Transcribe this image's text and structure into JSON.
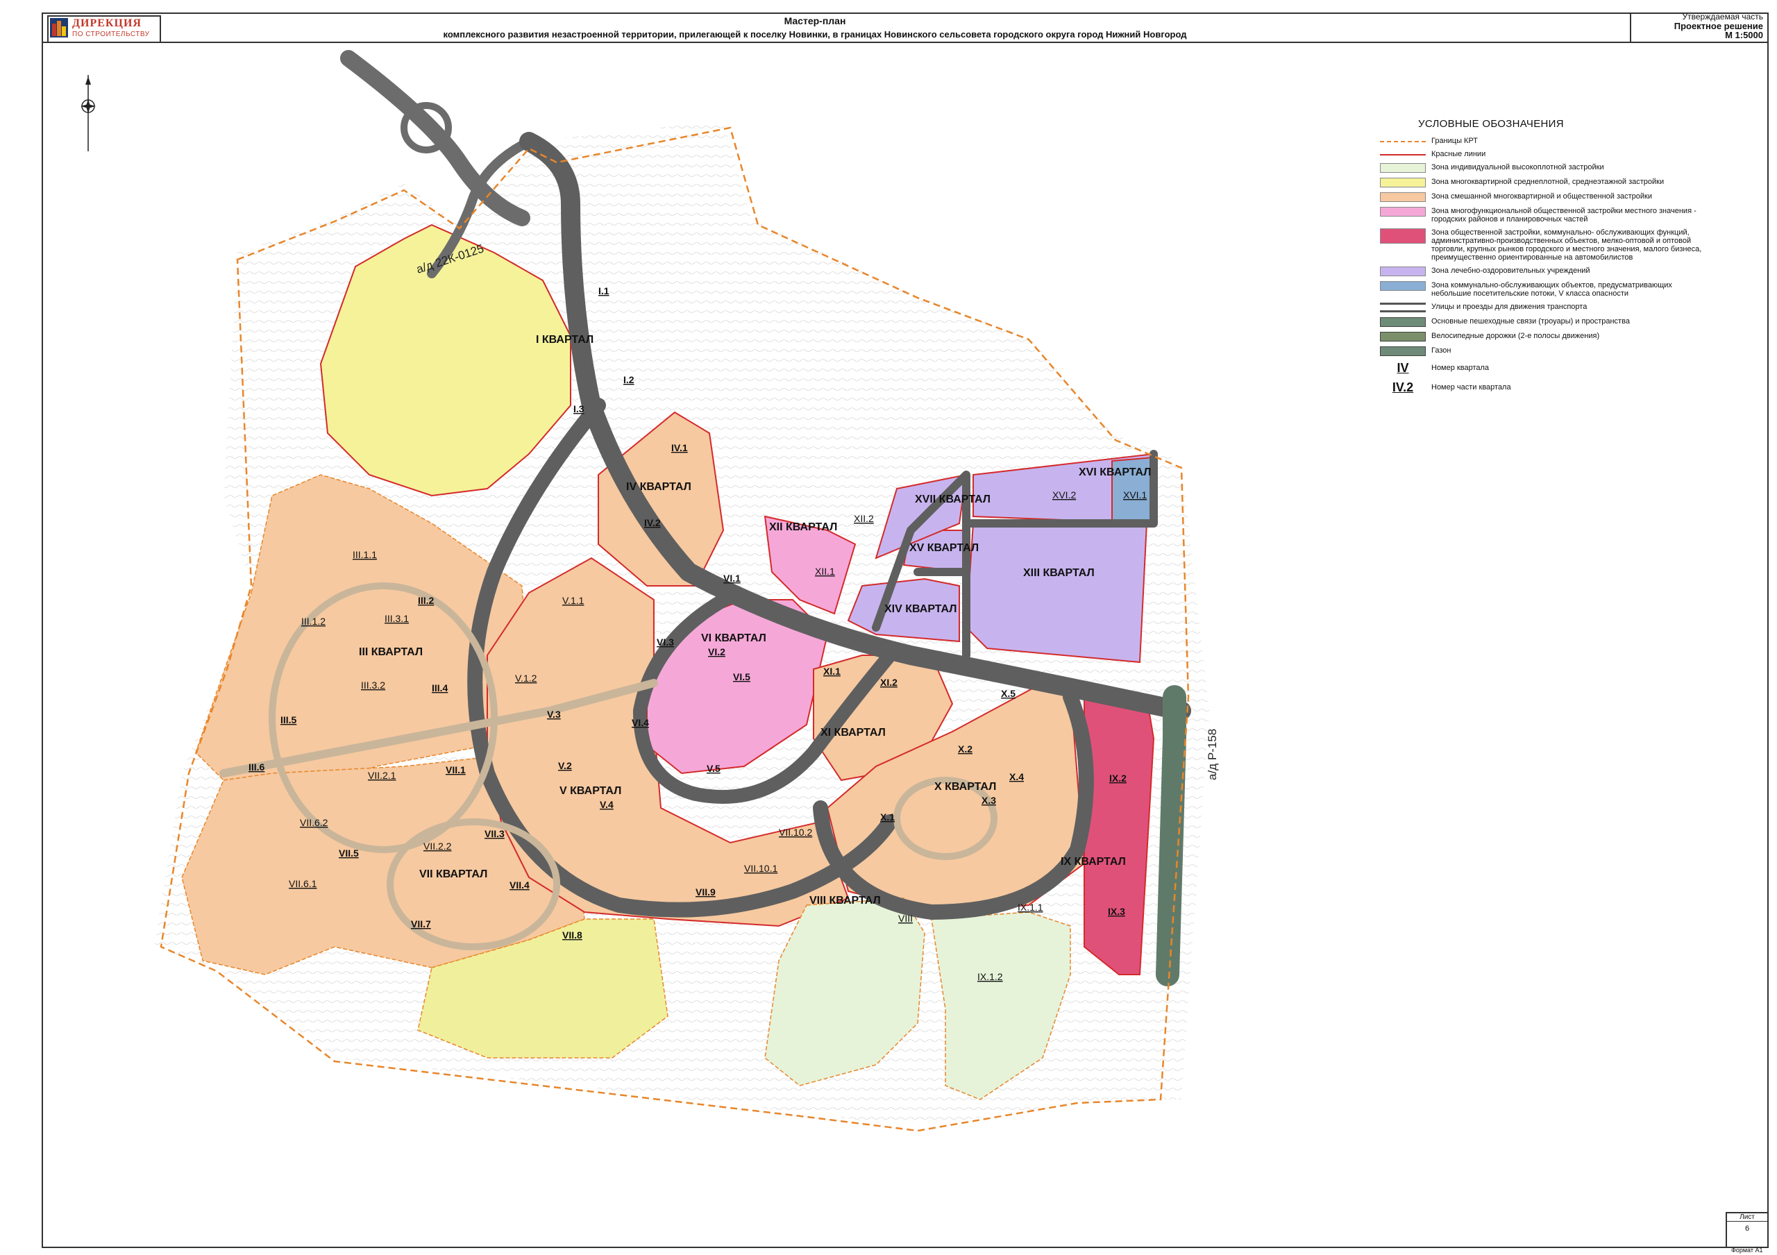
{
  "header": {
    "logo_line1": "ДИРЕКЦИЯ",
    "logo_line2": "ПО СТРОИТЕЛЬСТВУ",
    "title_line1": "Мастер-план",
    "title_line2": "комплексного развития незастроенной территории, прилегающей к поселку Новинки, в границах Новинского сельсовета городского округа город Нижний Новгород",
    "stamp_line1": "Утверждаемая часть",
    "stamp_line2": "Проектное решение",
    "stamp_line3": "М 1:5000"
  },
  "roads": {
    "road_nw": "а/д 22К-0125",
    "road_e": "а/д Р-158"
  },
  "quarters": {
    "q1": "I КВАРТАЛ",
    "q3": "III КВАРТАЛ",
    "q4": "IV КВАРТАЛ",
    "q5": "V КВАРТАЛ",
    "q6": "VI КВАРТАЛ",
    "q7": "VII КВАРТАЛ",
    "q8": "VIII КВАРТАЛ",
    "q9": "IX КВАРТАЛ",
    "q10": "X КВАРТАЛ",
    "q11": "XI КВАРТАЛ",
    "q12": "XII КВАРТАЛ",
    "q13": "XIII КВАРТАЛ",
    "q14": "XIV КВАРТАЛ",
    "q15": "XV КВАРТАЛ",
    "q16": "XVI КВАРТАЛ",
    "q17": "XVII КВАРТАЛ"
  },
  "parts": {
    "p1_1": "I.1",
    "p1_2": "I.2",
    "p1_3": "I.3",
    "p4_1": "IV.1",
    "p4_2": "IV.2",
    "p3_1_1": "III.1.1",
    "p3_1_2": "III.1.2",
    "p3_2": "III.2",
    "p3_3_1": "III.3.1",
    "p3_3_2": "III.3.2",
    "p3_4": "III.4",
    "p3_5": "III.5",
    "p3_6": "III.6",
    "p5_1_1": "V.1.1",
    "p5_1_2": "V.1.2",
    "p5_2": "V.2",
    "p5_3": "V.3",
    "p5_4": "V.4",
    "p5_5": "V.5",
    "p6_1": "VI.1",
    "p6_2": "VI.2",
    "p6_3": "VI.3",
    "p6_4": "VI.4",
    "p6_5": "VI.5",
    "p7_1": "VII.1",
    "p7_2_1": "VII.2.1",
    "p7_2_2": "VII.2.2",
    "p7_3": "VII.3",
    "p7_4": "VII.4",
    "p7_5": "VII.5",
    "p7_6_1": "VII.6.1",
    "p7_6_2": "VII.6.2",
    "p7_7": "VII.7",
    "p7_8": "VII.8",
    "p7_9": "VII.9",
    "p7_10_1": "VII.10.1",
    "p7_10_2": "VII.10.2",
    "p8": "VIII",
    "p9_1_1": "IX.1.1",
    "p9_1_2": "IX.1.2",
    "p9_2": "IX.2",
    "p9_3": "IX.3",
    "p10_1": "X.1",
    "p10_2": "X.2",
    "p10_3": "X.3",
    "p10_4": "X.4",
    "p10_5": "X.5",
    "p11_1": "XI.1",
    "p11_2": "XI.2",
    "p12_1": "XII.1",
    "p12_2": "XII.2",
    "p16_1": "XVI.1",
    "p16_2": "XVI.2"
  },
  "legend": {
    "title": "УСЛОВНЫЕ ОБОЗНАЧЕНИЯ",
    "items": [
      {
        "label": "Границы КРТ",
        "icon": "krt-boundary-swatch",
        "color": "#e8862a"
      },
      {
        "label": "Красные линии",
        "icon": "red-lines-swatch",
        "color": "#d42a2a"
      },
      {
        "label": "Зона индивидуальной высокоплотной застройки",
        "icon": "zone-individual-swatch",
        "color": "#e6f3d9"
      },
      {
        "label": "Зона многоквартирной среднеплотной, среднеэтажной застройки",
        "icon": "zone-midrise-swatch",
        "color": "#f5f29a"
      },
      {
        "label": "Зона смешанной многоквартирной и общественной застройки",
        "icon": "zone-mixed-swatch",
        "color": "#f6c9a0"
      },
      {
        "label": "Зона многофункциональной общественной застройки местного значения - городских районов и планировочных частей",
        "icon": "zone-multifunctional-swatch",
        "color": "#f5a8d8"
      },
      {
        "label": "Зона общественной застройки, коммунально- обслуживающих функций, административно-производственных объектов, мелко-оптовой и оптовой торговли, крупных рынков городского и местного значения, малого бизнеса, преимущественно ориентированные на автомобилистов",
        "icon": "zone-public-swatch",
        "color": "#e0517a"
      },
      {
        "label": "Зона лечебно-оздоровительных учреждений",
        "icon": "zone-medical-swatch",
        "color": "#c7b4ee"
      },
      {
        "label": "Зона коммунально-обслуживающих объектов, предусматривающих небольшие посетительские потоки, V класса опасности",
        "icon": "zone-utility-swatch",
        "color": "#8aaed4"
      },
      {
        "label": "Улицы и проезды для движения транспорта",
        "icon": "street-swatch",
        "color": "#555555"
      },
      {
        "label": "Основные пешеходные связи (троуары) и пространства",
        "icon": "pedestrian-swatch",
        "color": "#6f8c78"
      },
      {
        "label": "Велосипедные дорожки (2-е полосы движения)",
        "icon": "bike-path-swatch",
        "color": "#7a8f6a"
      },
      {
        "label": "Газон",
        "icon": "lawn-swatch",
        "color": "#6e8a78"
      }
    ],
    "quarter_number_sample": "IV",
    "quarter_number_label": "Номер квартала",
    "part_number_sample": "IV.2",
    "part_number_label": "Номер части квартала"
  },
  "sheet": {
    "label": "Лист",
    "number": "6",
    "format": "Формат А1"
  }
}
